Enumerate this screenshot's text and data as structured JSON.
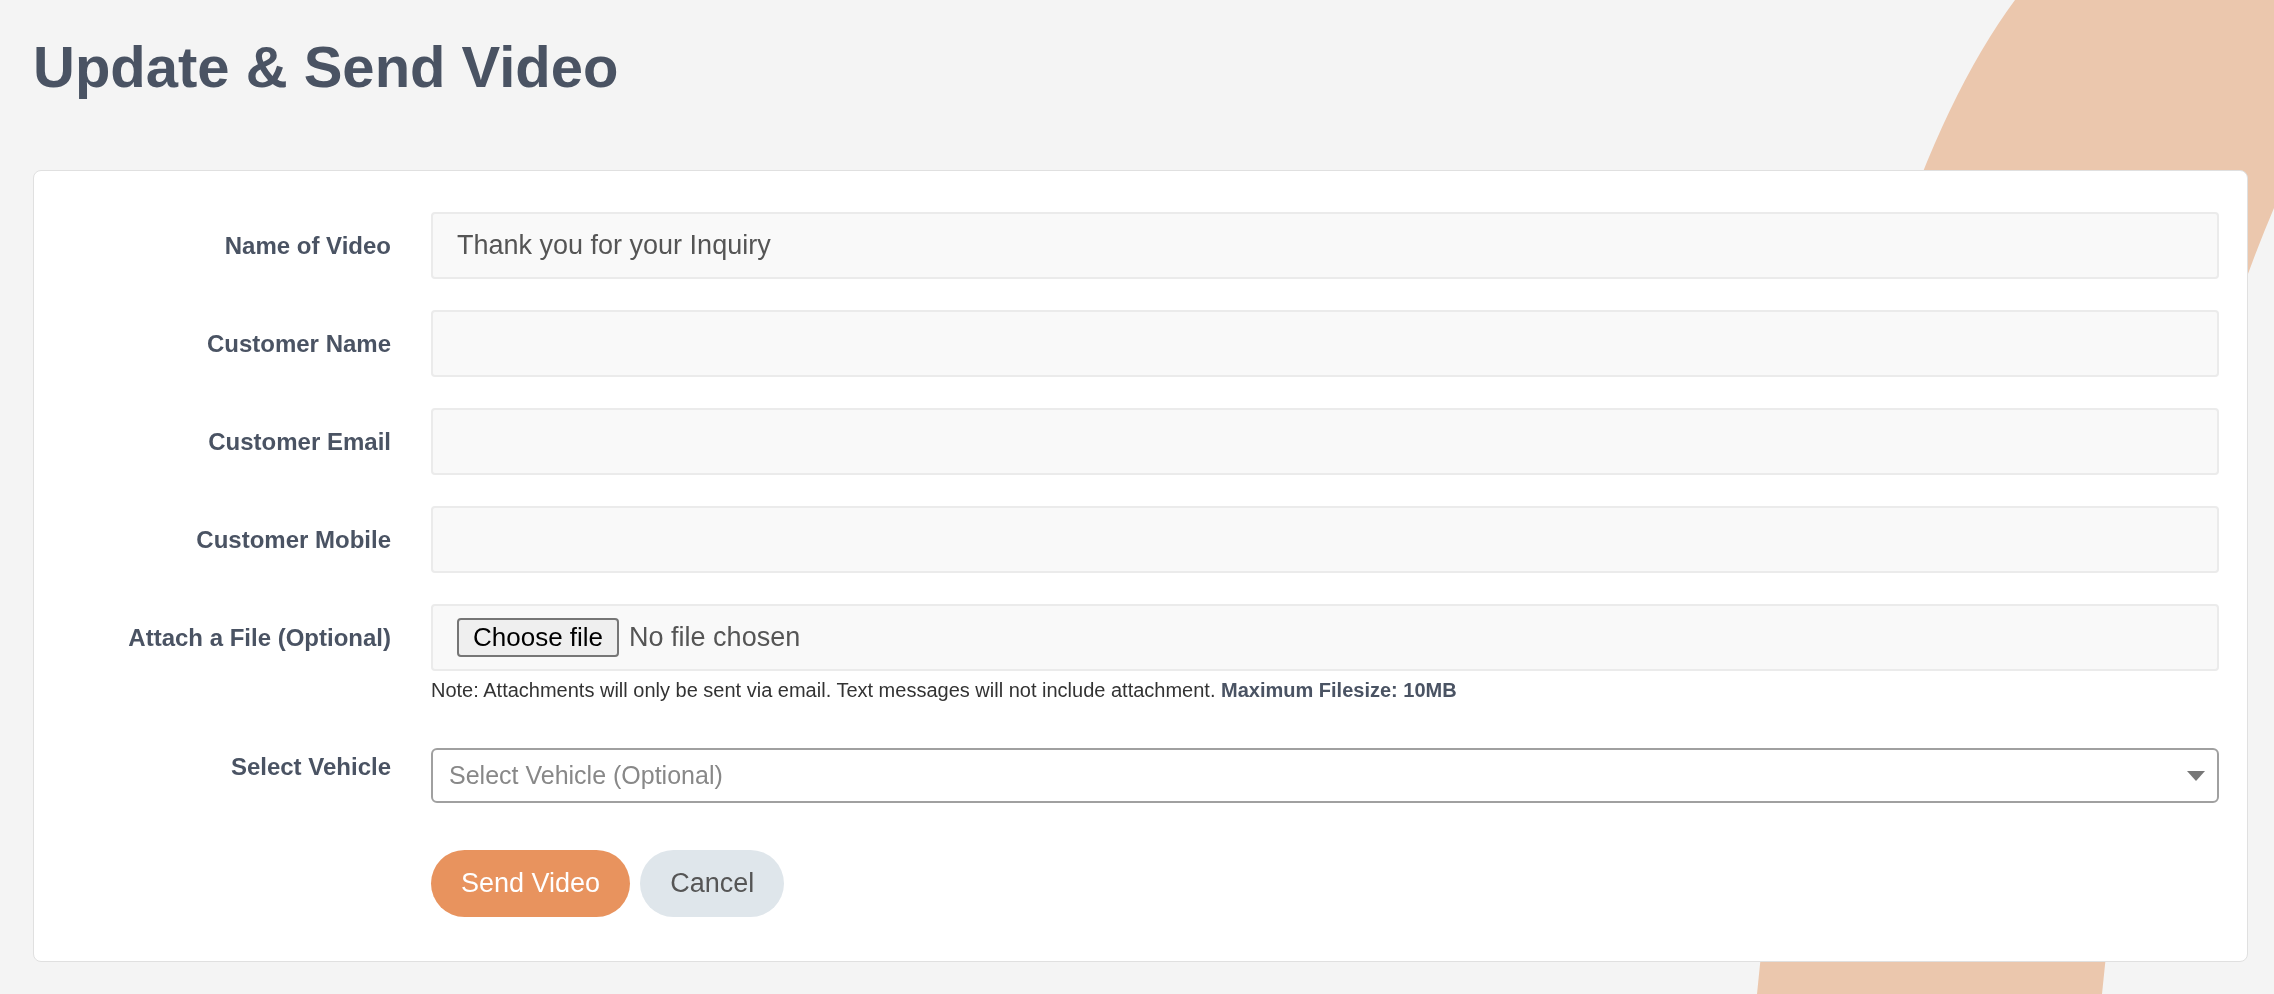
{
  "title": "Update & Send Video",
  "fields": [
    {
      "kind": "text",
      "label": "Name of Video",
      "value": "Thank you for your Inquiry"
    },
    {
      "kind": "text",
      "label": "Customer Name"
    },
    {
      "kind": "text",
      "label": "Customer Email"
    },
    {
      "kind": "text",
      "label": "Customer Mobile"
    },
    {
      "kind": "file",
      "label": "Attach a File (Optional)",
      "button": "Choose file",
      "status": "No file chosen",
      "note": "Note: Attachments will only be sent via email. Text messages will not include attachment. **Maximum Filesize: 10MB**"
    },
    {
      "kind": "select",
      "label": "Select Vehicle",
      "placeholder": "Select Vehicle (Optional)"
    }
  ],
  "buttons": [
    {
      "kind": "primary",
      "label": "Send Video"
    },
    {
      "kind": "secondary",
      "label": "Cancel"
    }
  ]
}
